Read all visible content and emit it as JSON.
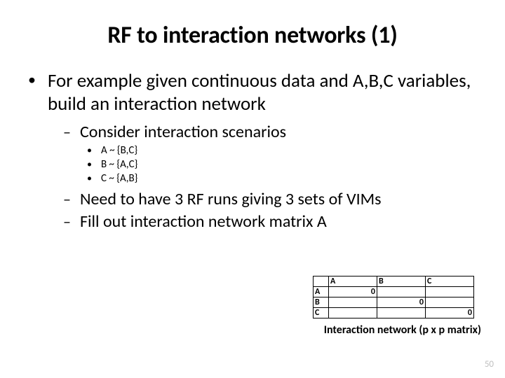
{
  "title": "RF to interaction networks (1)",
  "bullets": {
    "lvl1": "For example given continuous data and A,B,C variables, build an interaction network",
    "lvl2a": "Consider interaction scenarios",
    "lvl3a": "A ~ {B,C}",
    "lvl3b": "B ~ {A,C}",
    "lvl3c": "C ~ {A,B}",
    "lvl2b": "Need to have 3 RF runs giving 3 sets of VIMs",
    "lvl2c": "Fill out interaction network matrix A"
  },
  "matrix": {
    "cols": {
      "c1": "A",
      "c2": "B",
      "c3": "C"
    },
    "rows": {
      "r1": "A",
      "r2": "B",
      "r3": "C"
    },
    "diag": {
      "d1": "0",
      "d2": "0",
      "d3": "0"
    }
  },
  "caption": "Interaction network (p x p matrix)",
  "page": "50"
}
